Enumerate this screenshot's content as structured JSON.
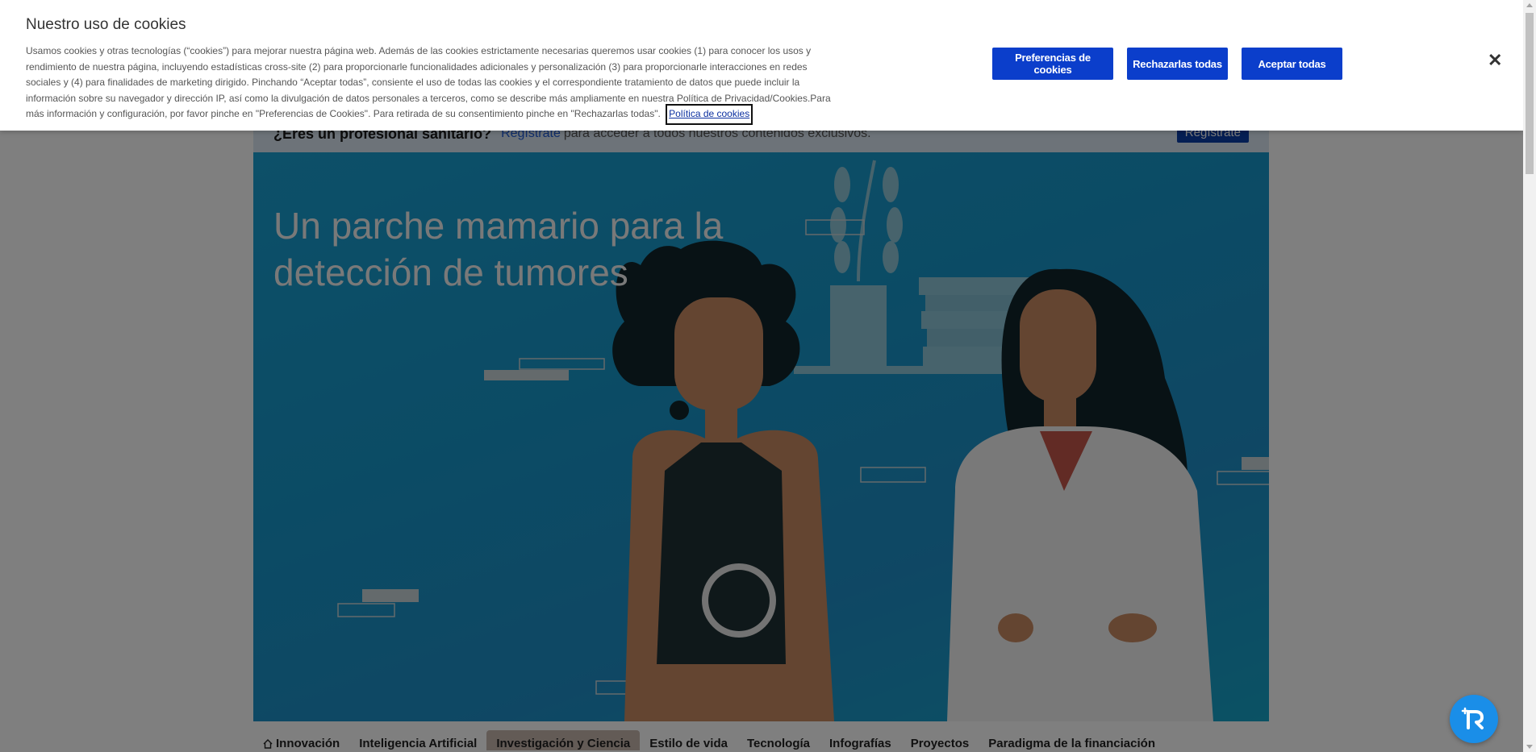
{
  "pro_bar": {
    "question": "¿Eres un profesional sanitario?",
    "link": "Regístrate",
    "rest": "para acceder a todos nuestros contenidos exclusivos.",
    "button": "Regístrate"
  },
  "hero": {
    "title": "Un parche mamario para la detección de tumores"
  },
  "nav": {
    "items": [
      "Innovación",
      "Inteligencia Artificial",
      "Investigación y Ciencia",
      "Estilo de vida",
      "Tecnología",
      "Infografías",
      "Proyectos",
      "Paradigma de la financiación"
    ],
    "active_index": 2,
    "home_icon": "home-icon"
  },
  "cookie": {
    "title": "Nuestro uso de cookies",
    "text": "Usamos cookies y otras tecnologías (“cookies”) para mejorar nuestra página web. Además de las cookies estrictamente necesarias queremos usar cookies (1) para conocer los usos y rendimiento de nuestra página, incluyendo estadísticas cross-site (2) para proporcionarle funcionalidades adicionales y personalización (3) para proporcionarle interacciones en redes sociales y (4) para finalidades de marketing dirigido. Pinchando “Aceptar todas”, consiente el uso de todas las cookies y el correspondiente tratamiento de datos que puede incluir la información sobre su navegador y dirección IP, así como la divulgación de datos personales a terceros, como se describe más ampliamente en nuestra Política de Privacidad/Cookies.Para más información y configuración, por favor pinche en \"Preferencias de Cookies\". Para retirada de su consentimiento pinche en \"Rechazarlas todas\".",
    "policy_link": "Política de cookies",
    "btn_preferences": "Preferencias de cookies",
    "btn_reject": "Rechazarlas todas",
    "btn_accept": "Aceptar todas",
    "close_icon": "close-icon"
  },
  "colors": {
    "button_blue": "#0b3ecb",
    "hero_blue": "#1797ca",
    "badge_blue": "#1a8ee8"
  }
}
